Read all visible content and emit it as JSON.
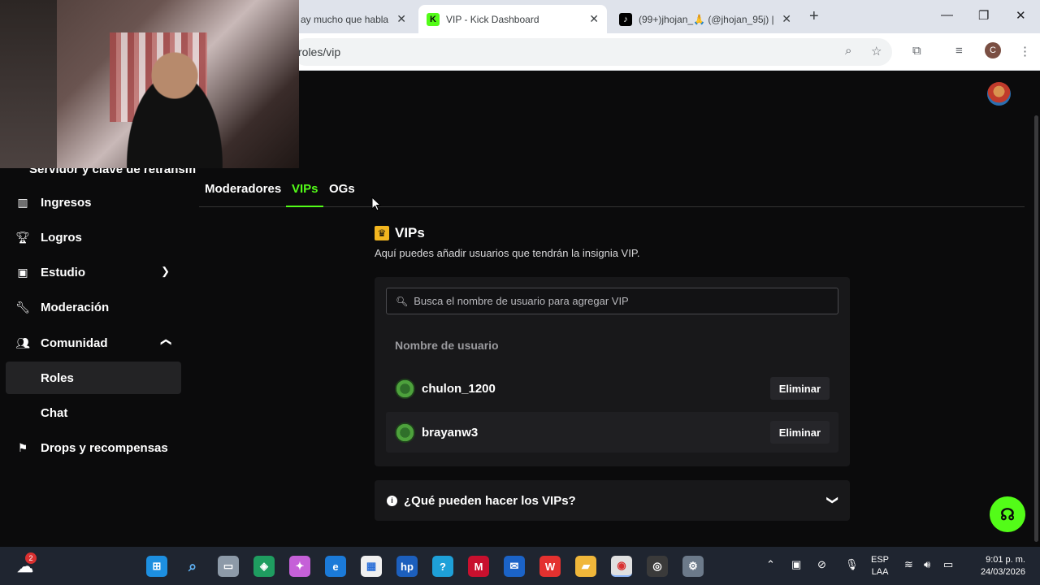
{
  "browser": {
    "tabs": [
      {
        "title": "ay mucho que habla",
        "active": false
      },
      {
        "title": "VIP - Kick Dashboard",
        "active": true,
        "favicon": "K"
      },
      {
        "title": "(99+)jhojan_🙏 (@jhojan_95j) |",
        "active": false
      }
    ],
    "url": "roles/vip",
    "profile_initial": "C"
  },
  "sidebar": {
    "cutoff_item": "Servidor y clave de retransm",
    "items": [
      {
        "label": "Ingresos",
        "icon": "bar-chart-icon"
      },
      {
        "label": "Logros",
        "icon": "trophy-icon"
      },
      {
        "label": "Estudio",
        "icon": "studio-icon",
        "chevron": "⌄"
      },
      {
        "label": "Moderación",
        "icon": "wrench-icon"
      },
      {
        "label": "Comunidad",
        "icon": "users-icon",
        "chevron": "⌃"
      }
    ],
    "sub_items": [
      {
        "label": "Roles",
        "active": true
      },
      {
        "label": "Chat",
        "active": false
      }
    ],
    "bottom_item": {
      "label": "Drops y recompensas",
      "icon": "drops-icon"
    }
  },
  "role_tabs": [
    {
      "label": "Moderadores",
      "active": false
    },
    {
      "label": "VIPs",
      "active": true
    },
    {
      "label": "OGs",
      "active": false
    }
  ],
  "section": {
    "title": "VIPs",
    "subtitle": "Aquí puedes añadir usuarios que tendrán la insignia VIP."
  },
  "search": {
    "placeholder": "Busca el nombre de usuario para agregar VIP",
    "value": ""
  },
  "table": {
    "column_header": "Nombre de usuario",
    "rows": [
      {
        "username": "chulon_1200",
        "action": "Eliminar"
      },
      {
        "username": "brayanw3",
        "action": "Eliminar"
      }
    ]
  },
  "faq": {
    "question": "¿Qué pueden hacer los VIPs?"
  },
  "taskbar": {
    "weather_badge": "2",
    "language": [
      "ESP",
      "LAA"
    ],
    "time": "9:01 p. m.",
    "date": "24/03/2026"
  },
  "colors": {
    "accent": "#53fc18",
    "background": "#0b0b0c",
    "card": "#18181a",
    "crown": "#f3b61f"
  }
}
